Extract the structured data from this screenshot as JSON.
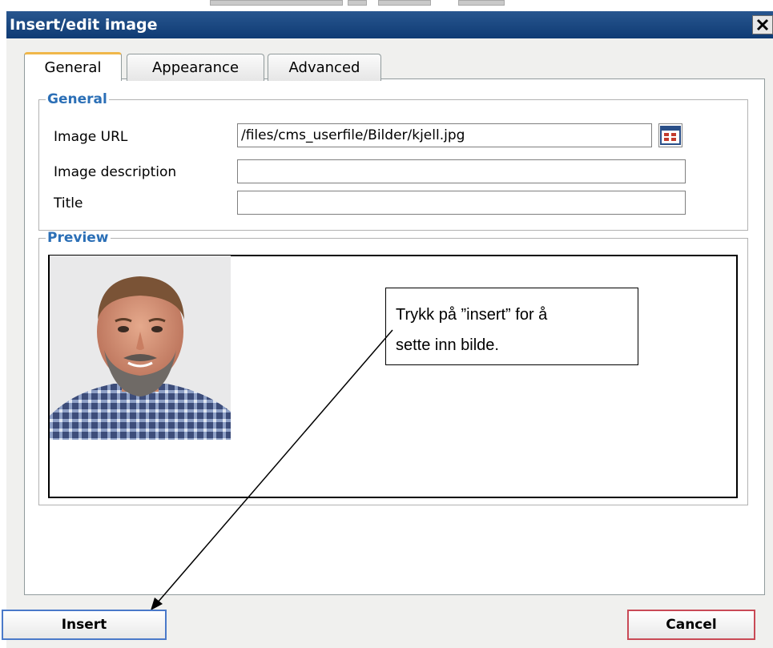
{
  "dialog": {
    "title": "Insert/edit image",
    "close_icon": "close-icon"
  },
  "tabs": [
    {
      "label": "General",
      "active": true
    },
    {
      "label": "Appearance",
      "active": false
    },
    {
      "label": "Advanced",
      "active": false
    }
  ],
  "general_section": {
    "legend": "General",
    "fields": {
      "image_url": {
        "label": "Image URL",
        "value": "/files/cms_userfile/Bilder/kjell.jpg"
      },
      "image_description": {
        "label": "Image description",
        "value": ""
      },
      "title": {
        "label": "Title",
        "value": ""
      }
    },
    "browse_icon": "file-browser-icon"
  },
  "preview_section": {
    "legend": "Preview",
    "image_icon": "portrait-photo"
  },
  "annotation": {
    "callout_line1": "Trykk på ”insert” for å",
    "callout_line2": "sette inn bilde."
  },
  "buttons": {
    "insert_label": "Insert",
    "cancel_label": "Cancel"
  },
  "colors": {
    "titlebar": "#1c4a84",
    "legend": "#2b6fb6",
    "active_tab_accent": "#f0b74a",
    "insert_border": "#4a79c9",
    "cancel_border": "#c94a56"
  }
}
